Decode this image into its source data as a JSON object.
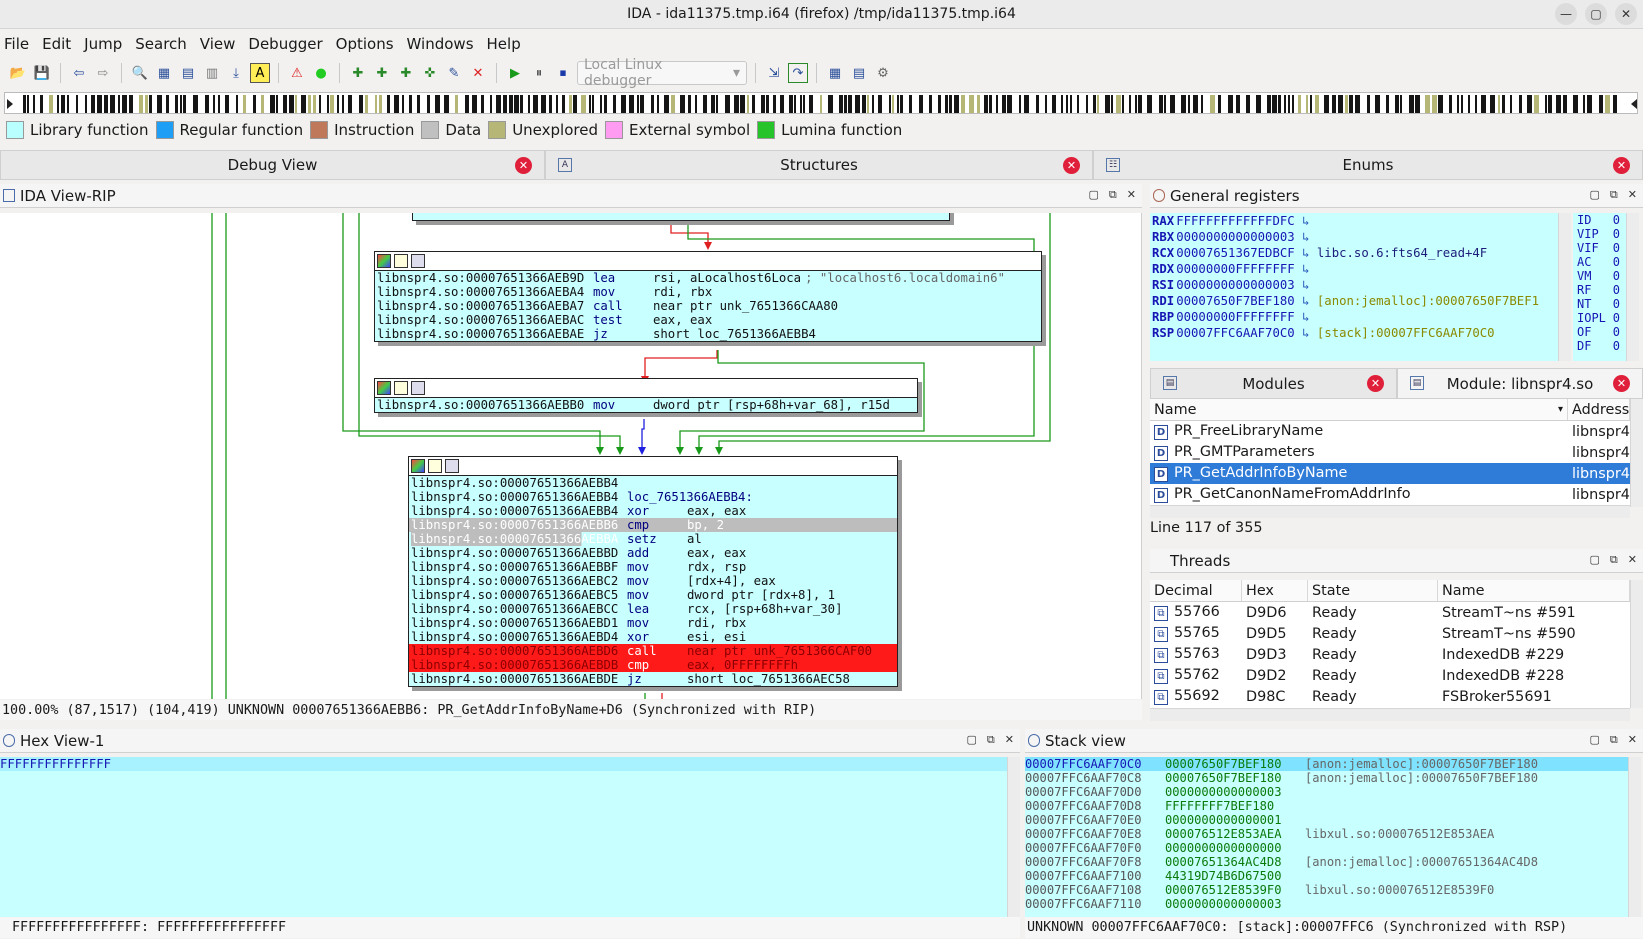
{
  "window": {
    "title": "IDA - ida11375.tmp.i64 (firefox) /tmp/ida11375.tmp.i64"
  },
  "menu": [
    "File",
    "Edit",
    "Jump",
    "Search",
    "View",
    "Debugger",
    "Options",
    "Windows",
    "Help"
  ],
  "toolbar": {
    "debugger_select": "Local Linux debugger"
  },
  "legend": [
    {
      "label": "Library function",
      "color": "#b9ffff"
    },
    {
      "label": "Regular function",
      "color": "#1e9ff5"
    },
    {
      "label": "Instruction",
      "color": "#c0785a"
    },
    {
      "label": "Data",
      "color": "#c0c0c0"
    },
    {
      "label": "Unexplored",
      "color": "#b6b677"
    },
    {
      "label": "External symbol",
      "color": "#ff9cf2"
    },
    {
      "label": "Lumina function",
      "color": "#27c32b"
    }
  ],
  "tabs": {
    "debug_view": "Debug View",
    "structures": "Structures",
    "enums": "Enums"
  },
  "ida_view": {
    "title": "IDA View-RIP",
    "node1": [
      {
        "addr": "libnspr4.so:00007651366AEB9D",
        "mn": "lea",
        "op": "rsi, aLocalhost6Loca",
        "cm": "; \"localhost6.localdomain6\""
      },
      {
        "addr": "libnspr4.so:00007651366AEBA4",
        "mn": "mov",
        "op": "rdi, rbx",
        "cm": ""
      },
      {
        "addr": "libnspr4.so:00007651366AEBA7",
        "mn": "call",
        "op": "near ptr unk_7651366CAA80",
        "cm": ""
      },
      {
        "addr": "libnspr4.so:00007651366AEBAC",
        "mn": "test",
        "op": "eax, eax",
        "cm": ""
      },
      {
        "addr": "libnspr4.so:00007651366AEBAE",
        "mn": "jz",
        "op": "short loc_7651366AEBB4",
        "cm": ""
      }
    ],
    "node2": [
      {
        "addr": "libnspr4.so:00007651366AEBB0",
        "mn": "mov",
        "op": "dword ptr [rsp+68h+var_68], r15d",
        "cm": ""
      }
    ],
    "node3": [
      {
        "addr": "libnspr4.so:00007651366AEBB4",
        "mn": "",
        "op": "",
        "cm": "",
        "state": ""
      },
      {
        "addr": "libnspr4.so:00007651366AEBB4",
        "mn": "loc_7651366AEBB4:",
        "op": "",
        "cm": "",
        "state": ""
      },
      {
        "addr": "libnspr4.so:00007651366AEBB4",
        "mn": "xor",
        "op": "eax, eax",
        "cm": "",
        "state": ""
      },
      {
        "addr": "libnspr4.so:00007651366AEBB6",
        "mn": "cmp",
        "op": "bp, 2",
        "cm": "",
        "state": "sel"
      },
      {
        "addr": "libnspr4.so:00007651366AEBBA",
        "mn": "setz",
        "op": "al",
        "cm": "",
        "state": "part"
      },
      {
        "addr": "libnspr4.so:00007651366AEBBD",
        "mn": "add",
        "op": "eax, eax",
        "cm": "",
        "state": ""
      },
      {
        "addr": "libnspr4.so:00007651366AEBBF",
        "mn": "mov",
        "op": "rdx, rsp",
        "cm": "",
        "state": ""
      },
      {
        "addr": "libnspr4.so:00007651366AEBC2",
        "mn": "mov",
        "op": "[rdx+4], eax",
        "cm": "",
        "state": ""
      },
      {
        "addr": "libnspr4.so:00007651366AEBC5",
        "mn": "mov",
        "op": "dword ptr [rdx+8], 1",
        "cm": "",
        "state": ""
      },
      {
        "addr": "libnspr4.so:00007651366AEBCC",
        "mn": "lea",
        "op": "rcx, [rsp+68h+var_30]",
        "cm": "",
        "state": ""
      },
      {
        "addr": "libnspr4.so:00007651366AEBD1",
        "mn": "mov",
        "op": "rdi, rbx",
        "cm": "",
        "state": ""
      },
      {
        "addr": "libnspr4.so:00007651366AEBD4",
        "mn": "xor",
        "op": "esi, esi",
        "cm": "",
        "state": ""
      },
      {
        "addr": "libnspr4.so:00007651366AEBD6",
        "mn": "call",
        "op": "near ptr unk_7651366CAF00",
        "cm": "",
        "state": "bp"
      },
      {
        "addr": "libnspr4.so:00007651366AEBDB",
        "mn": "cmp",
        "op": "eax, 0FFFFFFFFh",
        "cm": "",
        "state": "bp"
      },
      {
        "addr": "libnspr4.so:00007651366AEBDE",
        "mn": "jz",
        "op": "short loc_7651366AEC58",
        "cm": "",
        "state": ""
      }
    ],
    "status": "100.00% (87,1517) (104,419) UNKNOWN 00007651366AEBB6: PR_GetAddrInfoByName+D6 (Synchronized with RIP)"
  },
  "registers": {
    "title": "General registers",
    "rows": [
      {
        "name": "RAX",
        "value": "FFFFFFFFFFFFFDFC",
        "label": ""
      },
      {
        "name": "RBX",
        "value": "0000000000000003",
        "label": ""
      },
      {
        "name": "RCX",
        "value": "00007651367EDBCF",
        "label": "libc.so.6:fts64_read+4F"
      },
      {
        "name": "RDX",
        "value": "00000000FFFFFFFF",
        "label": ""
      },
      {
        "name": "RSI",
        "value": "0000000000000003",
        "label": ""
      },
      {
        "name": "RDI",
        "value": "00007650F7BEF180",
        "label": "[anon:jemalloc]:00007650F7BEF1"
      },
      {
        "name": "RBP",
        "value": "00000000FFFFFFFF",
        "label": ""
      },
      {
        "name": "RSP",
        "value": "00007FFC6AAF70C0",
        "label": "[stack]:00007FFC6AAF70C0"
      }
    ],
    "flags": [
      {
        "n": "ID",
        "v": "0"
      },
      {
        "n": "VIP",
        "v": "0"
      },
      {
        "n": "VIF",
        "v": "0"
      },
      {
        "n": "AC",
        "v": "0"
      },
      {
        "n": "VM",
        "v": "0"
      },
      {
        "n": "RF",
        "v": "0"
      },
      {
        "n": "NT",
        "v": "0"
      },
      {
        "n": "IOPL",
        "v": "0"
      },
      {
        "n": "OF",
        "v": "0"
      },
      {
        "n": "DF",
        "v": "0"
      }
    ]
  },
  "modules": {
    "tab1": "Modules",
    "tab2": "Module: libnspr4.so",
    "headers": {
      "name": "Name",
      "address": "Address"
    },
    "rows": [
      {
        "name": "PR_FreeLibraryName",
        "address": "libnspr4"
      },
      {
        "name": "PR_GMTParameters",
        "address": "libnspr4"
      },
      {
        "name": "PR_GetAddrInfoByName",
        "address": "libnspr4"
      },
      {
        "name": "PR_GetCanonNameFromAddrInfo",
        "address": "libnspr4"
      }
    ],
    "line_info": "Line 117 of 355"
  },
  "threads": {
    "title": "Threads",
    "headers": {
      "decimal": "Decimal",
      "hex": "Hex",
      "state": "State",
      "name": "Name"
    },
    "rows": [
      {
        "decimal": "55766",
        "hex": "D9D6",
        "state": "Ready",
        "name": "StreamT~ns #591"
      },
      {
        "decimal": "55765",
        "hex": "D9D5",
        "state": "Ready",
        "name": "StreamT~ns #590"
      },
      {
        "decimal": "55763",
        "hex": "D9D3",
        "state": "Ready",
        "name": "IndexedDB #229"
      },
      {
        "decimal": "55762",
        "hex": "D9D2",
        "state": "Ready",
        "name": "IndexedDB #228"
      },
      {
        "decimal": "55692",
        "hex": "D98C",
        "state": "Ready",
        "name": "FSBroker55691"
      }
    ]
  },
  "hexview": {
    "title": "Hex View-1",
    "line": "FFFFFFFFFFFFFFF",
    "status": "FFFFFFFFFFFFFFFF: FFFFFFFFFFFFFFFF"
  },
  "stack": {
    "title": "Stack view",
    "rows": [
      {
        "addr": "00007FFC6AAF70C0",
        "val": "00007650F7BEF180",
        "lbl": "[anon:jemalloc]:00007650F7BEF180"
      },
      {
        "addr": "00007FFC6AAF70C8",
        "val": "00007650F7BEF180",
        "lbl": "[anon:jemalloc]:00007650F7BEF180"
      },
      {
        "addr": "00007FFC6AAF70D0",
        "val": "0000000000000003",
        "lbl": ""
      },
      {
        "addr": "00007FFC6AAF70D8",
        "val": "FFFFFFFF7BEF180",
        "lbl": ""
      },
      {
        "addr": "00007FFC6AAF70E0",
        "val": "0000000000000001",
        "lbl": ""
      },
      {
        "addr": "00007FFC6AAF70E8",
        "val": "000076512E853AEA",
        "lbl": "libxul.so:000076512E853AEA"
      },
      {
        "addr": "00007FFC6AAF70F0",
        "val": "0000000000000000",
        "lbl": ""
      },
      {
        "addr": "00007FFC6AAF70F8",
        "val": "00007651364AC4D8",
        "lbl": "[anon:jemalloc]:00007651364AC4D8"
      },
      {
        "addr": "00007FFC6AAF7100",
        "val": "44319D74B6D67500",
        "lbl": ""
      },
      {
        "addr": "00007FFC6AAF7108",
        "val": "000076512E8539F0",
        "lbl": "libxul.so:000076512E8539F0"
      },
      {
        "addr": "00007FFC6AAF7110",
        "val": "0000000000000003",
        "lbl": ""
      }
    ],
    "status": "UNKNOWN 00007FFC6AAF70C0: [stack]:00007FFC6 (Synchronized with RSP)"
  }
}
